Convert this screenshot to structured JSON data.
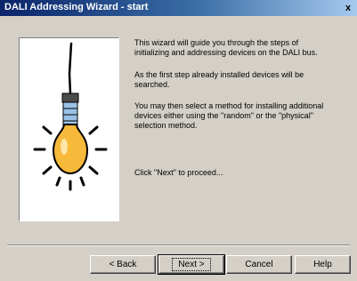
{
  "window": {
    "title": "DALI Addressing Wizard - start",
    "close_glyph": "x"
  },
  "content": {
    "paragraphs": [
      "This wizard will guide you through the steps of initializing and addressing devices on the DALI bus.",
      "As the first step already installed devices will be searched.",
      "You may then select a method for installing additional devices either using the \"random\" or the \"physical\" selection method.",
      "Click \"Next\" to proceed..."
    ]
  },
  "illustration": {
    "icon": "light-bulb-icon"
  },
  "buttons": {
    "back": "< Back",
    "next": "Next >",
    "cancel": "Cancel",
    "help": "Help"
  }
}
